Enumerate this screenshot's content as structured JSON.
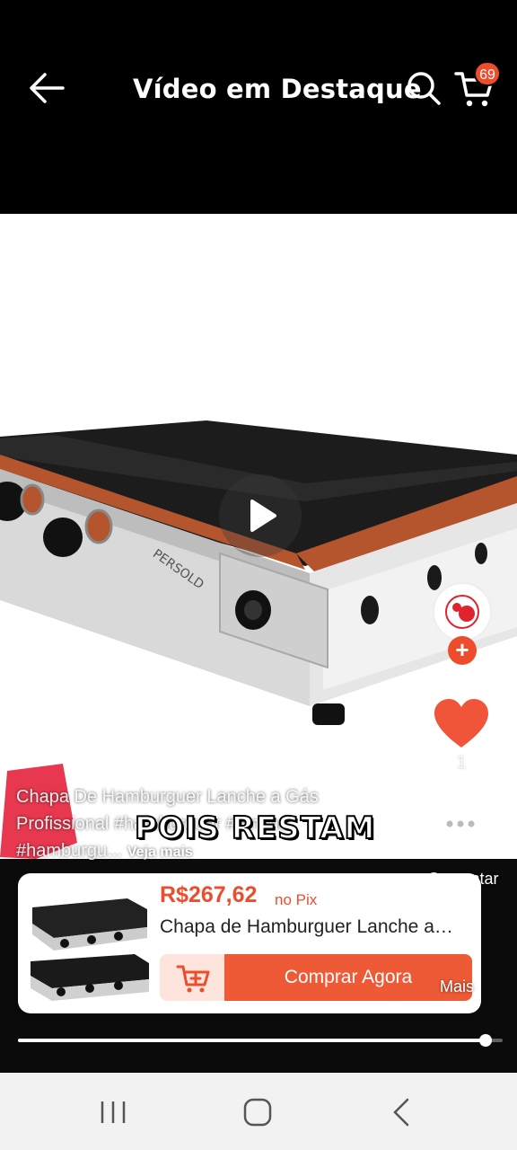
{
  "header": {
    "title": "Vídeo em Destaque",
    "cart_badge": "69"
  },
  "video": {
    "progress": 0.965,
    "overlay_text": "POIS RESTAM"
  },
  "actions": {
    "like_count": "1",
    "comment_label": "Comentar",
    "more_label": "Mais"
  },
  "caption": {
    "text": "Chapa De Hamburguer Lanche a Gás Profissional #hamburguer #lanche #hamburgu...",
    "see_more": "Veja mais"
  },
  "product": {
    "price": "R$267,62",
    "price_suffix": "no Pix",
    "name": "Chapa de Hamburguer Lanche a Gás Profissional",
    "buy_label": "Comprar Agora"
  },
  "colors": {
    "accent": "#ee4d2d",
    "buy_button": "#ee5a36",
    "cart_button_bg": "#fde4dc"
  }
}
